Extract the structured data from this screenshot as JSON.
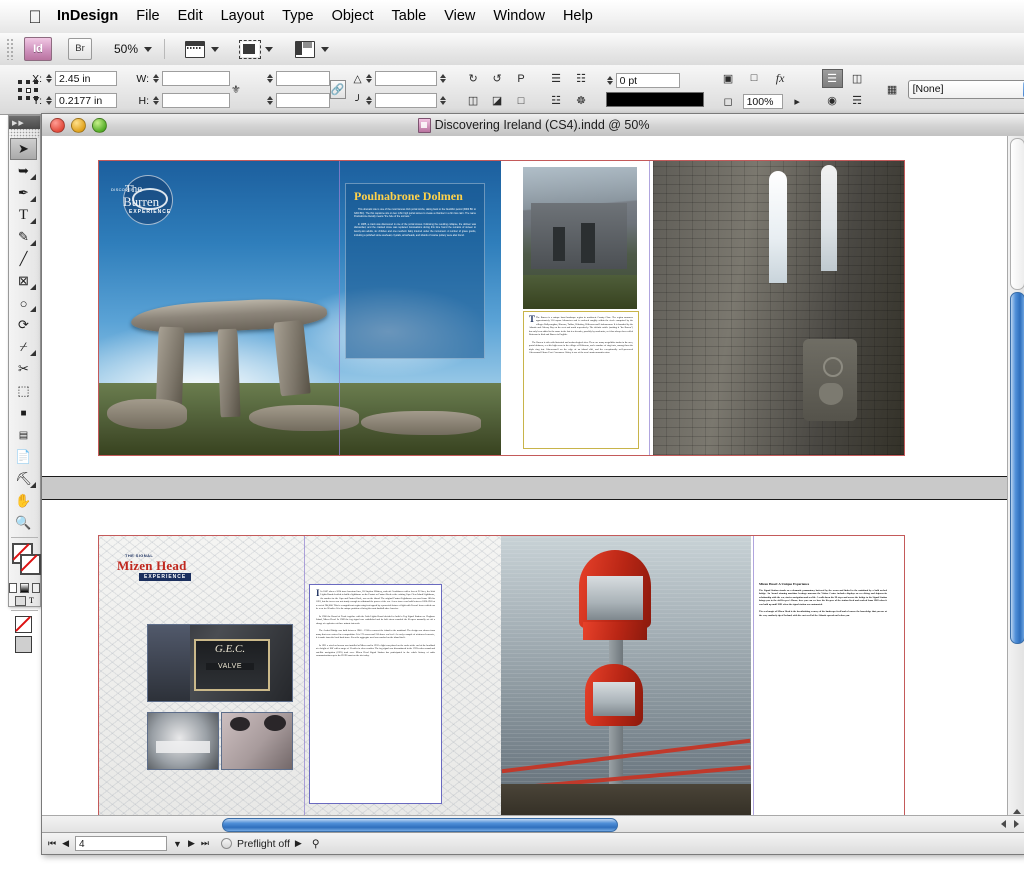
{
  "menubar": {
    "apple_icon": "apple-logo",
    "items": [
      "InDesign",
      "File",
      "Edit",
      "Layout",
      "Type",
      "Object",
      "Table",
      "View",
      "Window",
      "Help"
    ]
  },
  "apptoolbar": {
    "id_badge": "Id",
    "bridge_badge": "Br",
    "zoom_level": "50%",
    "view_icons": [
      "page-view-icon",
      "screen-mode-icon",
      "panel-layout-icon"
    ]
  },
  "control_panel": {
    "reference_point": "reference-point-proxy",
    "x_label": "X:",
    "x_value": "2.45 in",
    "y_label": "Y:",
    "y_value": "0.2177 in",
    "w_label": "W:",
    "w_value": "",
    "h_label": "H:",
    "h_value": "",
    "constrain_icon": "link-constrain-icon",
    "scale_x_value": "",
    "scale_y_value": "",
    "shear_value": "",
    "rotate_value": "",
    "rotate_icons": [
      "rotate-ccw-icon",
      "rotate-cw-icon",
      "flip-horizontal-icon",
      "flip-vertical-icon"
    ],
    "preview_letter": "P",
    "align_icons": [
      "align-top-icon",
      "distribute-horizontal-icon",
      "align-bottom-icon",
      "distribute-vertical-icon"
    ],
    "stroke_weight": "0 pt",
    "stroke_swatch_color": "#000000",
    "opacity_value": "100%",
    "effects_label": "fx",
    "object_style": "[None]",
    "text_wrap_icons": [
      "wrap-none-icon",
      "wrap-bounding-icon",
      "wrap-object-icon",
      "wrap-jump-icon"
    ]
  },
  "toolbox": {
    "tools": [
      {
        "name": "selection-tool",
        "glyph": "▶",
        "active": true
      },
      {
        "name": "direct-selection-tool",
        "glyph": "▷"
      },
      {
        "name": "pen-tool",
        "glyph": "✒"
      },
      {
        "name": "type-tool",
        "glyph": "T"
      },
      {
        "name": "pencil-tool",
        "glyph": "✎"
      },
      {
        "name": "line-tool",
        "glyph": "╲"
      },
      {
        "name": "rectangle-frame-tool",
        "glyph": "⌧"
      },
      {
        "name": "ellipse-tool",
        "glyph": "○"
      },
      {
        "name": "rotate-tool",
        "glyph": "↻"
      },
      {
        "name": "scale-tool",
        "glyph": "⤡"
      },
      {
        "name": "scissors-tool",
        "glyph": "✂"
      },
      {
        "name": "free-transform-tool",
        "glyph": "⬚"
      },
      {
        "name": "gradient-swatch-tool",
        "glyph": "■"
      },
      {
        "name": "gradient-feather-tool",
        "glyph": "▤"
      },
      {
        "name": "note-tool",
        "glyph": "☷"
      },
      {
        "name": "eyedropper-tool",
        "glyph": "⚗"
      },
      {
        "name": "hand-tool",
        "glyph": "✋"
      },
      {
        "name": "zoom-tool",
        "glyph": "⚲"
      }
    ],
    "fill_stroke": "fill-stroke-proxy",
    "apply_none_label": "none-swatch",
    "normal_view_label": "normal-view-mode",
    "preview_view_label": "preview-view-mode"
  },
  "document_window": {
    "title": "Discovering Ireland (CS4).indd @ 50%",
    "title_icon": "indesign-document-icon",
    "traffic_lights": [
      "close-button",
      "minimize-button",
      "zoom-button"
    ]
  },
  "statusbar": {
    "first_page_glyph": "⏮",
    "prev_page_glyph": "◀",
    "page_number": "4",
    "next_page_glyph": "▶",
    "last_page_glyph": "⏭",
    "preflight_label": "Preflight off",
    "preflight_menu_glyph": "▶",
    "document_menu_icon": "document-status-icon"
  },
  "spreads": [
    {
      "id": "spread-poulnabrone",
      "pages": [
        {
          "id": "page-poulnabrone-left",
          "logo": {
            "name": "the-burren-logo",
            "line1": "DISCOVER",
            "line2": "The",
            "line3": "Burren",
            "line4": "EXPERIENCE"
          },
          "headline": "Poulnabrone Dolmen",
          "headline_color": "#ffd24a",
          "paragraphs": [
            "This dramatic site is one of the most famous Irish portal tombs, dating back to the Neolithic period (3800 BC to 3200 BC). The thin capstone sits on two 1.8m high portal stones to create a chamber in a 9m low cairn. The name Poulnabrone literally means \"the hole of the sorrows.\"",
            "In 1985, a crack was discovered in one of the portal stones. Following the resulting collapse, the dolmen was dismantled, and the cracked stone was replaced. Excavations during this time found the remains of sixteen to twenty-two adults, six children and one newborn baby interred under the monument. A number of grave goods, including a polished stone axehead, crystals, arrowheads, and shards of coarse pottery were also found."
          ]
        },
        {
          "id": "page-poulnabrone-right",
          "paragraphs": [
            "The Burren is a unique karst landscape region in northwest County Clare. The region measures approximately 250 square kilometres and is enclosed roughly within the circle comprised by the villages Ballyvaughan, Kinvara, Tubber, Kilnaboy, Kilfenora and Lisdoonvarna. It is bounded by the Atlantic and Galway Bay on the west and north respectively. The definite article (making it \"the Burren\") has only been added to the name in the last few decades, possibly by academics, as it has always been called Boireann in Irish and Burren in English.",
            "The Burren is rich with historical and archaeological sites. There are many megalithic tombs in the area, portal dolmens, a celtic high cross in the village of Kilfenora, and a number of ring forts, among them the triple ring fort Caherconnell on the edge of an inland cliff, and the exceptionally well-preserved Caherconnell Stone Fort. Corcomroe Abbey is one of the area's main monastic ruins."
          ]
        }
      ]
    },
    {
      "id": "spread-mizen-head",
      "pages": [
        {
          "id": "page-mizen-left",
          "logo": {
            "name": "mizen-head-logo",
            "line1": "THE SIGNAL",
            "line2": "Mizen Head",
            "line3": "EXPERIENCE"
          },
          "photo_caption_1": "G.E.C.",
          "photo_caption_2": "VALVE",
          "paragraphs": [
            "In 1847 when a 1024 tons American liner, SS Stephen Whitney, sank off Crookhaven with a loss of 92 lives, the Irish Lights Board decided to build a lighthouse on the Fastnet or Fastnet Rock or the existing Cape Clear Island Lighthouse, the marker for the Cape and Fastnet Rock, was on the island. The original Fastnet Lighthouse was used from 1854 to 1891, but the tower was not sturdy enough to withstand the power of the sea. A new tower was built between 1896-1903 at a cost of £84,000. This is a magnificent engineering feat topped by a powerful fixture of light with Fresnel lenses which can be seen for 38 miles. It is the unique position of being the most landfall after America.",
            "In 1906 the Board of Trade together with the Irish Lights Board decided to build a Fog Signal Station on Cloghane Island, Mizen Head. In 1909 the fog signal was established and its half sirens sounded the Keepers manually set off a charge of explosives at three minute intervals.",
            "The Arched Bridge was built between 1908 – 1910 to connect the island to the mainland. The design was chosen from many that were entered in a competition. It is 172 across and 150 above sea level. An early example of reinforced concrete, it is made from the local hard stone. Even the aggregate used was crushed on the island itself.",
            "In 1931 a wireless beacon was installed at Mizen and in 1959 a light was placed on the rocks at the end of the headland at a height of 180' with a range of 13 miles in clear weather. The fog signal was discontinued in the 1970s when sound and satellite navigation (GPS) took over. Mizen Head Signal Station has participated in the whole history of radio communications up to the DGPS mast on the site today."
          ]
        },
        {
          "id": "page-mizen-right",
          "headline": "Mizen Head: A Unique Experience",
          "paragraphs": [
            "The Signal Station stands on a dramatic promontory battered by the ocean and linked to the mainland by a bold arched bridge. An Award winning maritime heritage museum the Visitor Centre includes displays on sea diving and shipwrecks relationship with the sea, stories navigation and sea life. A walk down the 99 steps and across the bridge to the Signal Station brings you to the old Keeper's House, here you can see how the Keepers of the station lived and worked from 1909 when it was built up until 1993 when the signal station was automated.",
            "The real magic of Mizen Head is the breathtaking scenery of the landscape itself and of course the knowledge that you are at the very southerly tip of Ireland, with the vast swell of the Atlantic spread out before you."
          ]
        }
      ]
    }
  ],
  "colors": {
    "headline_yellow": "#ffd24a",
    "accent_red": "#c0271e",
    "scrollbar_blue": "#2f6fbd",
    "page_guide_red": "#c45a5a",
    "guide_violet": "#8f7fd0"
  }
}
